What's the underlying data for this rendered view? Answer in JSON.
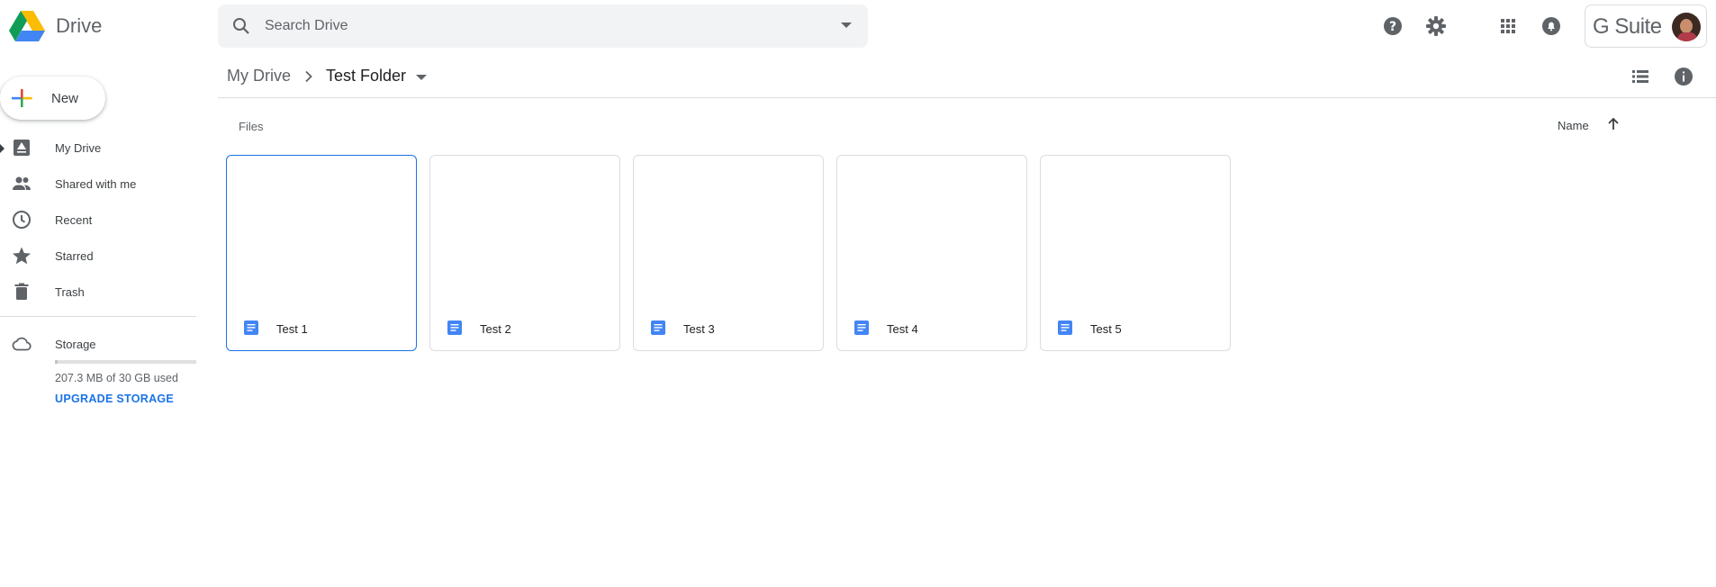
{
  "header": {
    "brand": "Drive",
    "search_placeholder": "Search Drive",
    "gsuite_label": "G Suite",
    "icons": [
      "help-icon",
      "settings-icon",
      "apps-grid-icon",
      "notifications-icon"
    ]
  },
  "sidebar": {
    "new_label": "New",
    "items": [
      {
        "label": "My Drive",
        "icon": "my-drive-icon"
      },
      {
        "label": "Shared with me",
        "icon": "people-icon"
      },
      {
        "label": "Recent",
        "icon": "clock-icon"
      },
      {
        "label": "Starred",
        "icon": "star-icon"
      },
      {
        "label": "Trash",
        "icon": "trash-icon"
      }
    ],
    "storage": {
      "label": "Storage",
      "used_text": "207.3 MB of 30 GB used",
      "used_fraction": 0.007,
      "upgrade_label": "UPGRADE STORAGE"
    }
  },
  "main": {
    "breadcrumb": {
      "root": "My Drive",
      "current": "Test Folder"
    },
    "section_label": "Files",
    "sort": {
      "label": "Name",
      "direction": "ascending"
    },
    "files": [
      {
        "title": "Test 1",
        "selected": true
      },
      {
        "title": "Test 2",
        "selected": false
      },
      {
        "title": "Test 3",
        "selected": false
      },
      {
        "title": "Test 4",
        "selected": false
      },
      {
        "title": "Test 5",
        "selected": false
      }
    ]
  },
  "colors": {
    "accent": "#1a73e8",
    "doc_blue": "#4285f4",
    "text_secondary": "#5f6368",
    "divider": "#dadce0"
  }
}
